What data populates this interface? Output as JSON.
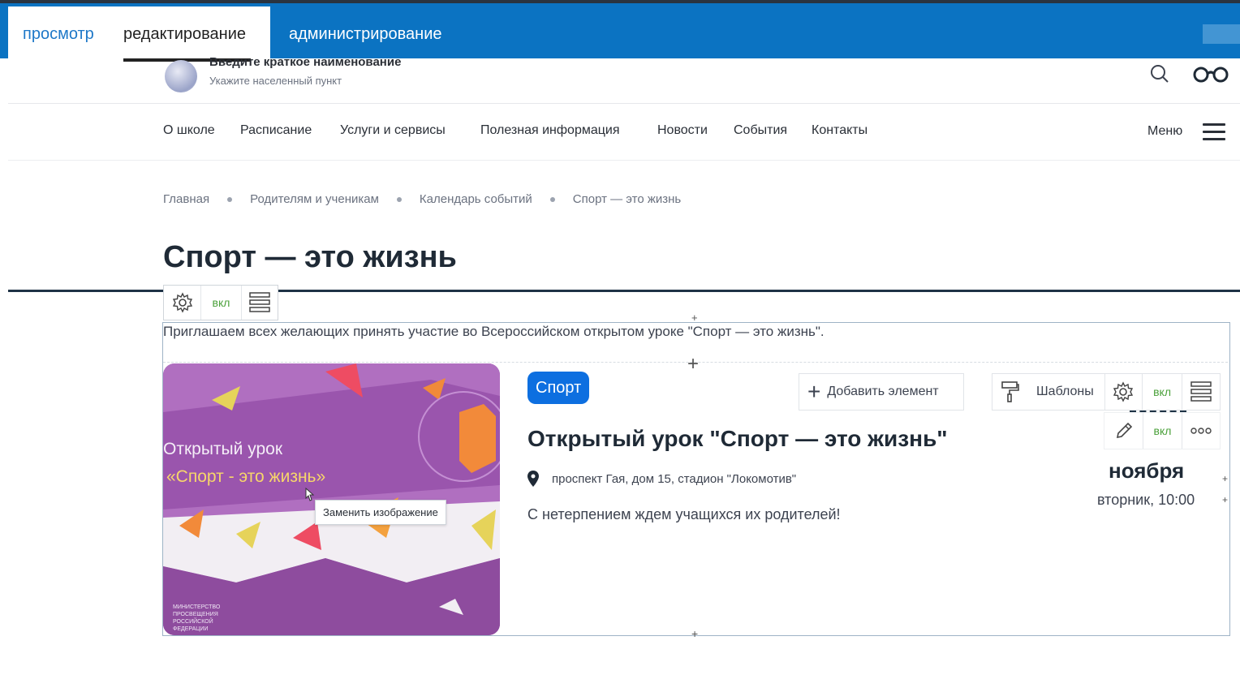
{
  "admin_tabs": {
    "view": "просмотр",
    "edit": "редактирование",
    "admin": "администрирование"
  },
  "site_header": {
    "name": "Введите краткое наименование",
    "place": "Укажите населенный пункт"
  },
  "nav": {
    "items": [
      "О школе",
      "Расписание",
      "Услуги и сервисы",
      "Полезная информация",
      "Новости",
      "События",
      "Контакты"
    ],
    "menu_label": "Меню"
  },
  "breadcrumb": [
    "Главная",
    "Родителям и ученикам",
    "Календарь событий",
    "Спорт — это жизнь"
  ],
  "page": {
    "title": "Спорт — это жизнь",
    "intro": "Приглашаем всех желающих принять участие во Всероссийском открытом уроке \"Спорт — это жизнь\"."
  },
  "toolbar": {
    "vkl": "вкл"
  },
  "event": {
    "tag": "Спорт",
    "title": "Открытый урок \"Спорт — это жизнь\"",
    "location": "проспект Гая, дом 15, стадион \"Локомотив\"",
    "description": "С нетерпением ждем учащихся их родителей!",
    "month": "ноября",
    "day_time": "вторник, 10:00",
    "image_text_1": "Открытый урок",
    "image_text_2": "«Спорт - это жизнь»",
    "image_footer": "МИНИСТЕРСТВО ПРОСВЕЩЕНИЯ РОССИЙСКОЙ ФЕДЕРАЦИИ"
  },
  "editor": {
    "add_element": "Добавить элемент",
    "templates": "Шаблоны",
    "vkl_1": "вкл",
    "vkl_2": "вкл",
    "replace_image": "Заменить изображение"
  },
  "colors": {
    "admin_bar": "#0b73c2",
    "tag": "#0d6fe0",
    "vkl": "#4aa03a"
  }
}
